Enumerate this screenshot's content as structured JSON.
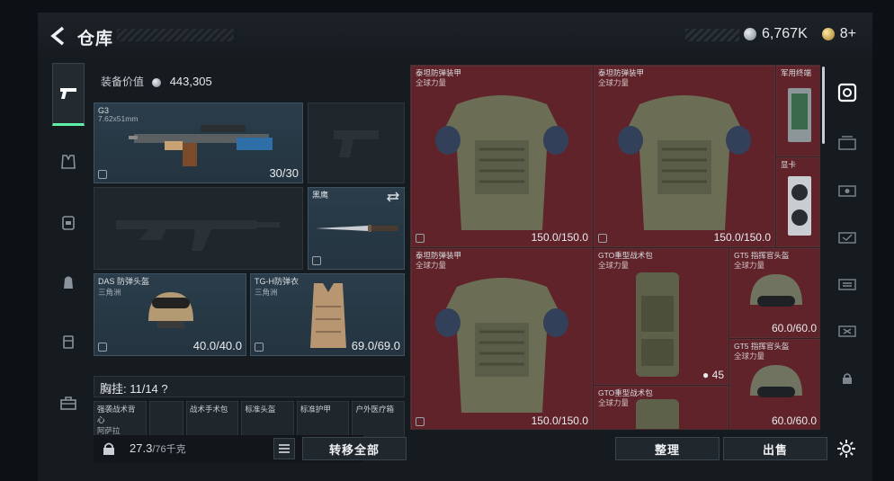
{
  "header": {
    "title": "仓库",
    "currency": "6,767K",
    "gold": "8+"
  },
  "equipment": {
    "value_label": "装备价值",
    "value": "443,305",
    "primary": {
      "name": "G3",
      "caliber": "7.62x51mm",
      "count": "30/30"
    },
    "knife": {
      "name": "黑鹰"
    },
    "helmet": {
      "name": "DAS 防弹头盔",
      "sub": "三角洲",
      "count": "40.0/40.0"
    },
    "armor": {
      "name": "TG-H防弹衣",
      "sub": "三角洲",
      "count": "69.0/69.0"
    },
    "chest_label": "胸挂: 11/14 ?",
    "chest_slots": [
      "强袭战术背心",
      "战术手术包",
      "标准头盔",
      "标准护甲",
      "户外医疗箱"
    ],
    "chest_slot_sub": "阿萨拉"
  },
  "storage": {
    "items": [
      {
        "name": "泰坦防弹装甲",
        "sub": "全球力量",
        "count": "150.0/150.0"
      },
      {
        "name": "泰坦防弹装甲",
        "sub": "全球力量",
        "count": "150.0/150.0"
      },
      {
        "name": "军用终端",
        "sub": "",
        "count": ""
      },
      {
        "name": "显卡",
        "sub": "",
        "count": ""
      },
      {
        "name": "泰坦防弹装甲",
        "sub": "全球力量",
        "count": "150.0/150.0"
      },
      {
        "name": "GTO重型战术包",
        "sub": "全球力量",
        "count": "45"
      },
      {
        "name": "GT5 指挥官头盔",
        "sub": "全球力量",
        "count": "60.0/60.0"
      },
      {
        "name": "GT5 指挥官头盔",
        "sub": "全球力量",
        "count": "60.0/60.0"
      },
      {
        "name": "GTO重型战术包",
        "sub": "全球力量",
        "count": ""
      }
    ]
  },
  "bottom": {
    "weight": "27.3",
    "weight_cap": "/76千克",
    "transfer_all": "转移全部",
    "sort": "整理",
    "sell": "出售"
  },
  "colors": {
    "accent": "#5ef0a6",
    "storage_bg": "#6e262e"
  }
}
